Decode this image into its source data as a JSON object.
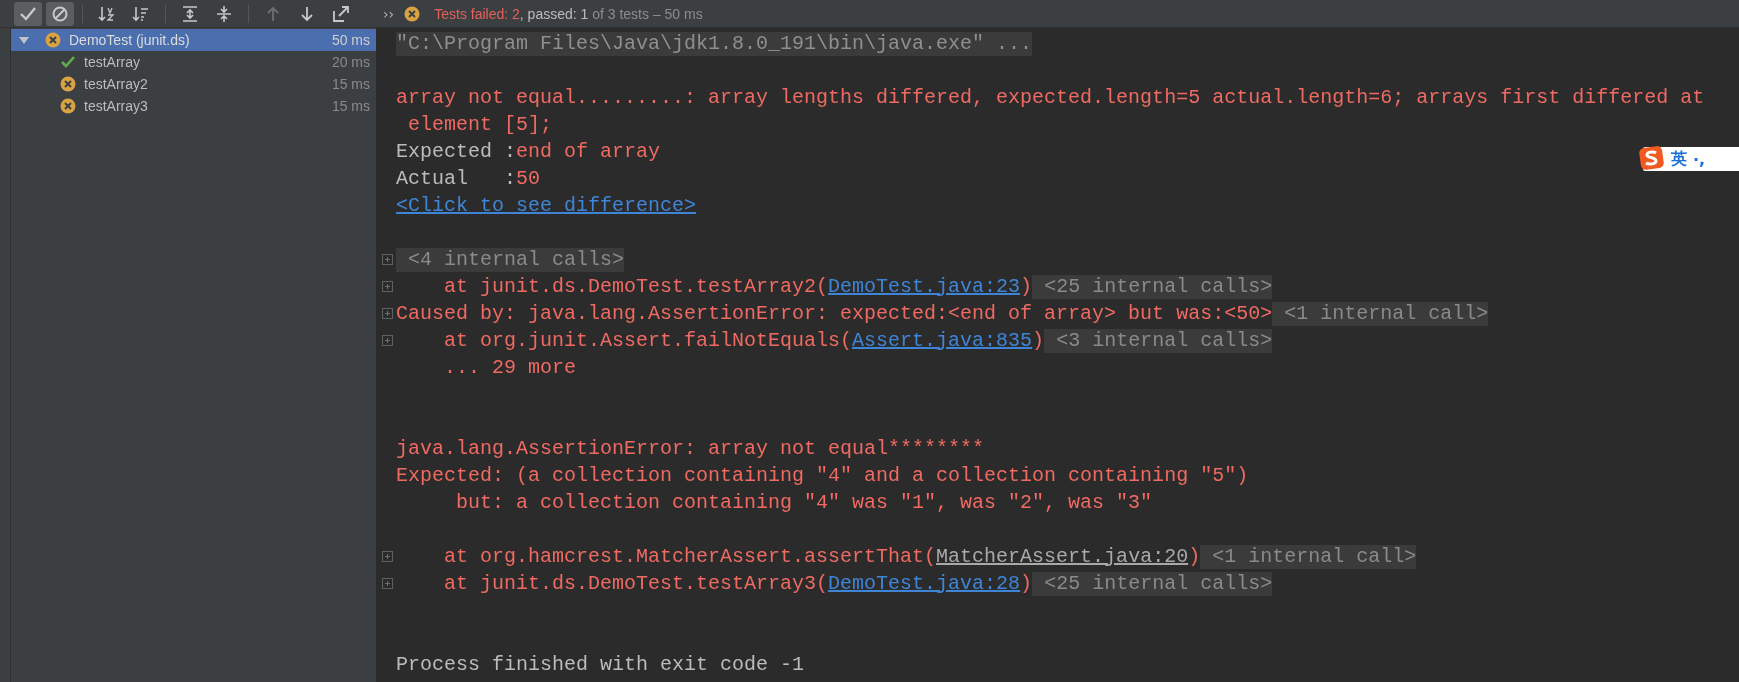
{
  "toolbar": {
    "buttons": [
      {
        "on": true,
        "disabled": false
      },
      {
        "on": true,
        "disabled": false
      },
      {
        "on": false,
        "disabled": false
      },
      {
        "on": false,
        "disabled": false
      },
      {
        "on": false,
        "disabled": false
      },
      {
        "on": false,
        "disabled": false
      },
      {
        "on": false,
        "disabled": true
      },
      {
        "on": false,
        "disabled": false
      },
      {
        "on": false,
        "disabled": false
      }
    ],
    "overflow": "››",
    "status": {
      "failed": true,
      "failed_text": "Tests failed: 2",
      "passed_text": ", passed: 1",
      "total_text": " of 3 tests – 50 ms"
    }
  },
  "tree": {
    "name": "DemoTest (junit.ds)",
    "time": "50 ms",
    "failed": true,
    "selected": true,
    "expanded": true,
    "children": [
      {
        "name": "testArray",
        "time": "20 ms",
        "failed": false,
        "selected": false
      },
      {
        "name": "testArray2",
        "time": "15 ms",
        "failed": true,
        "selected": false
      },
      {
        "name": "testArray3",
        "time": "15 ms",
        "failed": true,
        "selected": false
      }
    ]
  },
  "console": {
    "lines": [
      {
        "kind": "text",
        "foldable": false,
        "segments": [
          {
            "kind": "command",
            "text": "\"C:\\Program Files\\Java\\jdk1.8.0_191\\bin\\java.exe\" ..."
          }
        ]
      },
      {
        "kind": "blank"
      },
      {
        "kind": "text",
        "foldable": false,
        "segments": [
          {
            "kind": "error",
            "text": "array not equal.........: array lengths differed, expected.length=5 actual.length=6; arrays first differed at"
          }
        ]
      },
      {
        "kind": "text",
        "foldable": false,
        "segments": [
          {
            "kind": "error",
            "text": " element [5];"
          }
        ]
      },
      {
        "kind": "text",
        "foldable": false,
        "segments": [
          {
            "kind": "plain",
            "text": "Expected :"
          },
          {
            "kind": "error",
            "text": "end of array"
          }
        ]
      },
      {
        "kind": "text",
        "foldable": false,
        "segments": [
          {
            "kind": "plain",
            "text": "Actual   :"
          },
          {
            "kind": "error",
            "text": "50"
          }
        ]
      },
      {
        "kind": "text",
        "foldable": false,
        "segments": [
          {
            "kind": "link",
            "text": "<Click to see difference>"
          }
        ]
      },
      {
        "kind": "blank"
      },
      {
        "kind": "text",
        "foldable": true,
        "segments": [
          {
            "kind": "folded",
            "text": " <4 internal calls>"
          }
        ]
      },
      {
        "kind": "text",
        "foldable": true,
        "segments": [
          {
            "kind": "error",
            "text": "    at junit.ds.DemoTest.testArray2("
          },
          {
            "kind": "link",
            "text": "DemoTest.java:23"
          },
          {
            "kind": "error",
            "text": ")"
          },
          {
            "kind": "folded",
            "text": " <25 internal calls>"
          }
        ]
      },
      {
        "kind": "text",
        "foldable": true,
        "segments": [
          {
            "kind": "error",
            "text": "Caused by: java.lang.AssertionError: expected:<end of array> but was:<50>"
          },
          {
            "kind": "folded",
            "text": " <1 internal call>"
          }
        ]
      },
      {
        "kind": "text",
        "foldable": true,
        "segments": [
          {
            "kind": "error",
            "text": "    at org.junit.Assert.failNotEquals("
          },
          {
            "kind": "link",
            "text": "Assert.java:835"
          },
          {
            "kind": "error",
            "text": ")"
          },
          {
            "kind": "folded",
            "text": " <3 internal calls>"
          }
        ]
      },
      {
        "kind": "text",
        "foldable": false,
        "segments": [
          {
            "kind": "error",
            "text": "    ... 29 more"
          }
        ]
      },
      {
        "kind": "blank"
      },
      {
        "kind": "blank"
      },
      {
        "kind": "text",
        "foldable": false,
        "segments": [
          {
            "kind": "error",
            "text": "java.lang.AssertionError: array not equal********"
          }
        ]
      },
      {
        "kind": "text",
        "foldable": false,
        "segments": [
          {
            "kind": "error",
            "text": "Expected: (a collection containing \"4\" and a collection containing \"5\")"
          }
        ]
      },
      {
        "kind": "text",
        "foldable": false,
        "segments": [
          {
            "kind": "error",
            "text": "     but: a collection containing \"4\" was \"1\", was \"2\", was \"3\""
          }
        ]
      },
      {
        "kind": "blank"
      },
      {
        "kind": "text",
        "foldable": true,
        "segments": [
          {
            "kind": "library",
            "text": "    at org.hamcrest.MatcherAssert.assertThat("
          },
          {
            "kind": "librarylink",
            "text": "MatcherAssert.java:20"
          },
          {
            "kind": "error",
            "text": ")"
          },
          {
            "kind": "folded",
            "text": " <1 internal call>"
          }
        ]
      },
      {
        "kind": "text",
        "foldable": true,
        "segments": [
          {
            "kind": "error",
            "text": "    at junit.ds.DemoTest.testArray3("
          },
          {
            "kind": "link",
            "text": "DemoTest.java:28"
          },
          {
            "kind": "error",
            "text": ")"
          },
          {
            "kind": "folded",
            "text": " <25 internal calls>"
          }
        ]
      },
      {
        "kind": "blank"
      },
      {
        "kind": "blank"
      },
      {
        "kind": "text",
        "foldable": false,
        "segments": [
          {
            "kind": "plain",
            "text": "Process finished with exit code -1"
          }
        ]
      }
    ]
  },
  "ime_bar": {
    "mode": "英",
    "punctuation": "·,"
  }
}
